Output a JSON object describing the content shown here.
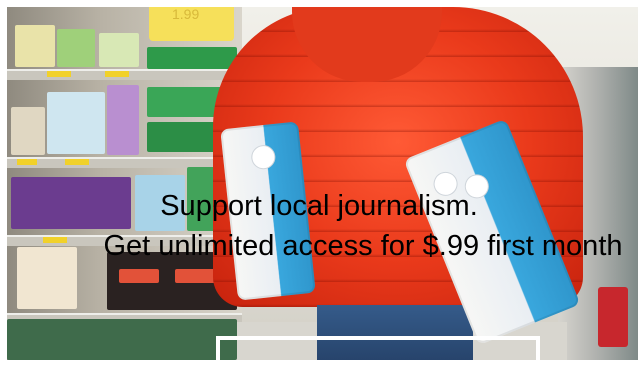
{
  "promo": {
    "line1": "Support local journalism.",
    "line2": "Get unlimited access for $.99 first month"
  },
  "cta": {
    "label": ""
  },
  "image": {
    "sign_text": "1.99"
  },
  "colors": {
    "overlay_text": "#000000",
    "jacket": "#ea3a1b",
    "pack_blue": "#39a7dd",
    "cta_border": "#ffffff"
  }
}
